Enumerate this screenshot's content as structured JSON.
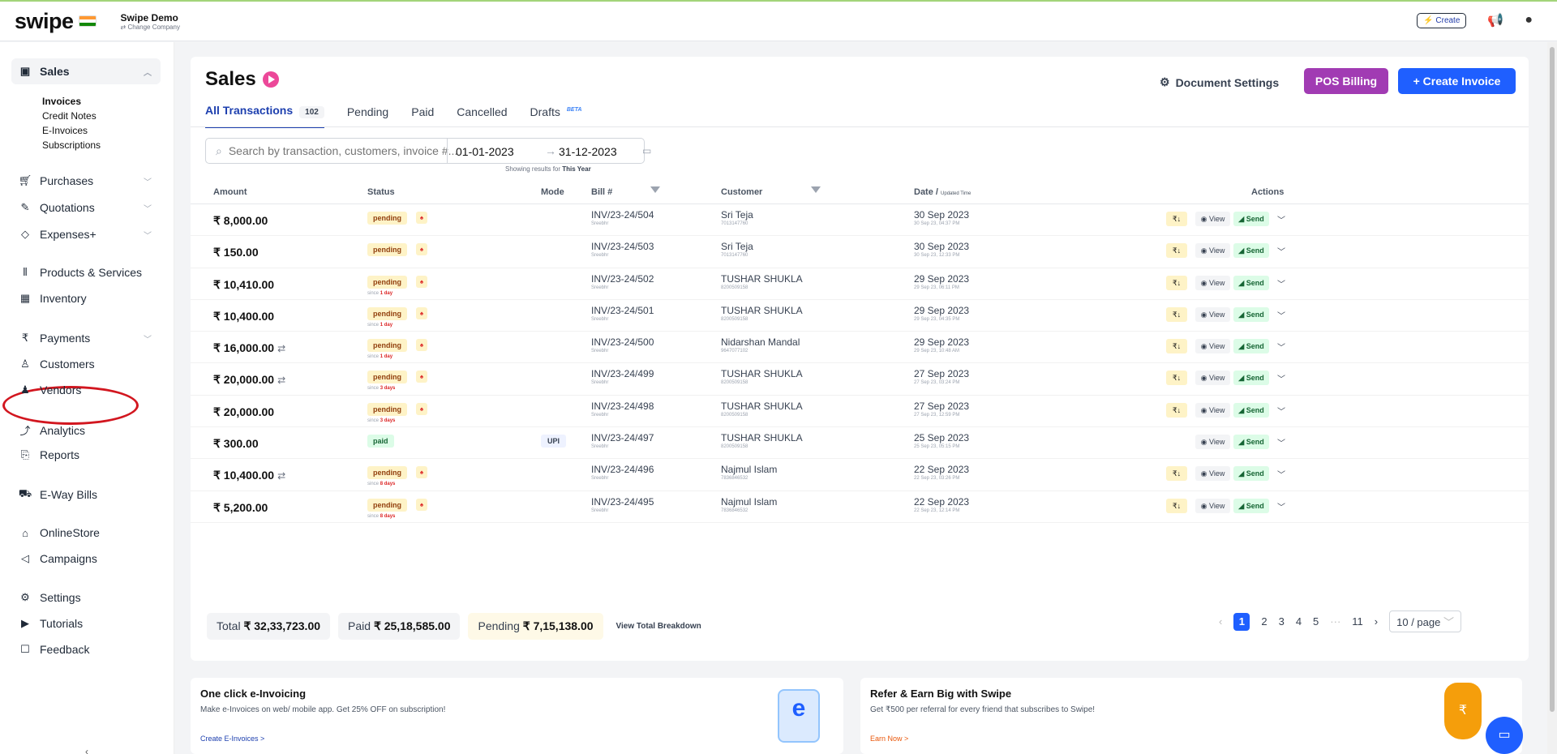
{
  "topbar": {
    "brand": "swipe",
    "company_name": "Swipe Demo",
    "change_company": "⇄ Change Company",
    "create_label": "⚡ Create",
    "icons": [
      "megaphone-icon",
      "user-icon"
    ]
  },
  "sidebar": {
    "items": [
      {
        "label": "Sales",
        "icon": "cash-icon"
      },
      {
        "label": "Purchases",
        "icon": "cart-icon"
      },
      {
        "label": "Quotations",
        "icon": "pen-icon"
      },
      {
        "label": "Expenses+",
        "icon": "tag-icon"
      },
      {
        "label": "Products & Services",
        "icon": "barcode-icon"
      },
      {
        "label": "Inventory",
        "icon": "inventory-icon"
      },
      {
        "label": "Payments",
        "icon": "rupee-icon"
      },
      {
        "label": "Customers",
        "icon": "user-icon"
      },
      {
        "label": "Vendors",
        "icon": "users-icon"
      },
      {
        "label": "Analytics",
        "icon": "chart-icon"
      },
      {
        "label": "Reports",
        "icon": "report-icon"
      },
      {
        "label": "E-Way Bills",
        "icon": "truck-icon"
      },
      {
        "label": "OnlineStore",
        "icon": "store-icon"
      },
      {
        "label": "Campaigns",
        "icon": "megaphone-icon"
      },
      {
        "label": "Settings",
        "icon": "gear-icon"
      },
      {
        "label": "Tutorials",
        "icon": "youtube-icon"
      },
      {
        "label": "Feedback",
        "icon": "message-icon"
      }
    ],
    "sales_sub": [
      "Invoices",
      "Credit Notes",
      "E-Invoices",
      "Subscriptions"
    ]
  },
  "main": {
    "title": "Sales",
    "doc_settings": "Document Settings",
    "pos_billing": "POS Billing",
    "create_invoice": "+ Create Invoice",
    "tabs": [
      {
        "label": "All Transactions",
        "count": "102"
      },
      {
        "label": "Pending"
      },
      {
        "label": "Paid"
      },
      {
        "label": "Cancelled"
      },
      {
        "label": "Drafts",
        "badge": "BETA"
      }
    ],
    "search_placeholder": "Search by transaction, customers, invoice #...",
    "date_start": "01-01-2023",
    "date_end": "31-12-2023",
    "showing_prefix": "Showing results for",
    "showing_value": "This Year",
    "columns": {
      "amount": "Amount",
      "status": "Status",
      "mode": "Mode",
      "bill": "Bill #",
      "customer": "Customer",
      "date": "Date /",
      "date_small": "Updated Time",
      "actions": "Actions"
    },
    "rows": [
      {
        "amount": "₹ 8,000.00",
        "recurring": false,
        "status": "pending",
        "since": "",
        "since_val": "",
        "mode": "",
        "bill": "INV/23-24/504",
        "bill_sub": "Sreebhr",
        "customer": "Sri Teja",
        "cust_sub": "7013147760",
        "date": "30 Sep 2023",
        "date_sub": "30 Sep 23, 04:37 PM",
        "rupee": true
      },
      {
        "amount": "₹ 150.00",
        "recurring": false,
        "status": "pending",
        "since": "",
        "since_val": "",
        "mode": "",
        "bill": "INV/23-24/503",
        "bill_sub": "Sreebhr",
        "customer": "Sri Teja",
        "cust_sub": "7013147760",
        "date": "30 Sep 2023",
        "date_sub": "30 Sep 23, 12:33 PM",
        "rupee": true
      },
      {
        "amount": "₹ 10,410.00",
        "recurring": false,
        "status": "pending",
        "since": "since",
        "since_val": "1 day",
        "mode": "",
        "bill": "INV/23-24/502",
        "bill_sub": "Sreebhr",
        "customer": "TUSHAR SHUKLA",
        "cust_sub": "8200509158",
        "date": "29 Sep 2023",
        "date_sub": "29 Sep 23, 06:11 PM",
        "rupee": true
      },
      {
        "amount": "₹ 10,400.00",
        "recurring": false,
        "status": "pending",
        "since": "since",
        "since_val": "1 day",
        "mode": "",
        "bill": "INV/23-24/501",
        "bill_sub": "Sreebhr",
        "customer": "TUSHAR SHUKLA",
        "cust_sub": "8200509158",
        "date": "29 Sep 2023",
        "date_sub": "29 Sep 23, 04:35 PM",
        "rupee": true
      },
      {
        "amount": "₹ 16,000.00",
        "recurring": true,
        "status": "pending",
        "since": "since",
        "since_val": "1 day",
        "mode": "",
        "bill": "INV/23-24/500",
        "bill_sub": "Sreebhr",
        "customer": "Nidarshan Mandal",
        "cust_sub": "9647077102",
        "date": "29 Sep 2023",
        "date_sub": "29 Sep 23, 10:48 AM",
        "rupee": true
      },
      {
        "amount": "₹ 20,000.00",
        "recurring": true,
        "status": "pending",
        "since": "since",
        "since_val": "3 days",
        "mode": "",
        "bill": "INV/23-24/499",
        "bill_sub": "Sreebhr",
        "customer": "TUSHAR SHUKLA",
        "cust_sub": "8200509158",
        "date": "27 Sep 2023",
        "date_sub": "27 Sep 23, 03:24 PM",
        "rupee": true
      },
      {
        "amount": "₹ 20,000.00",
        "recurring": false,
        "status": "pending",
        "since": "since",
        "since_val": "3 days",
        "mode": "",
        "bill": "INV/23-24/498",
        "bill_sub": "Sreebhr",
        "customer": "TUSHAR SHUKLA",
        "cust_sub": "8200509158",
        "date": "27 Sep 2023",
        "date_sub": "27 Sep 23, 12:59 PM",
        "rupee": true
      },
      {
        "amount": "₹ 300.00",
        "recurring": false,
        "status": "paid",
        "since": "",
        "since_val": "",
        "mode": "UPI",
        "bill": "INV/23-24/497",
        "bill_sub": "Sreebhr",
        "customer": "TUSHAR SHUKLA",
        "cust_sub": "8200509158",
        "date": "25 Sep 2023",
        "date_sub": "25 Sep 23, 05:15 PM",
        "rupee": false
      },
      {
        "amount": "₹ 10,400.00",
        "recurring": true,
        "status": "pending",
        "since": "since",
        "since_val": "8 days",
        "mode": "",
        "bill": "INV/23-24/496",
        "bill_sub": "Sreebhr",
        "customer": "Najmul Islam",
        "cust_sub": "7836846532",
        "date": "22 Sep 2023",
        "date_sub": "22 Sep 23, 03:26 PM",
        "rupee": true
      },
      {
        "amount": "₹ 5,200.00",
        "recurring": false,
        "status": "pending",
        "since": "since",
        "since_val": "8 days",
        "mode": "",
        "bill": "INV/23-24/495",
        "bill_sub": "Sreebhr",
        "customer": "Najmul Islam",
        "cust_sub": "7836846532",
        "date": "22 Sep 2023",
        "date_sub": "22 Sep 23, 12:14 PM",
        "rupee": true
      }
    ],
    "view_label": "◉ View",
    "send_label": "◢ Send",
    "rupee_label": "₹↓",
    "totals": {
      "total_label": "Total",
      "total_value": "₹ 32,33,723.00",
      "paid_label": "Paid",
      "paid_value": "₹ 25,18,585.00",
      "pending_label": "Pending",
      "pending_value": "₹ 7,15,138.00",
      "breakdown": "View Total Breakdown"
    },
    "pagination": {
      "pages": [
        "1",
        "2",
        "3",
        "4",
        "5",
        "···",
        "11"
      ],
      "current": "1",
      "per_page": "10 / page"
    }
  },
  "promos": {
    "einvoice": {
      "title": "One click e-Invoicing",
      "text": "Make e-Invoices on web/ mobile app. Get 25% OFF on subscription!",
      "link": "Create E-Invoices >"
    },
    "refer": {
      "title": "Refer & Earn Big with Swipe",
      "text": "Get ₹500 per referral for every friend that subscribes to Swipe!",
      "link": "Earn Now >"
    }
  }
}
